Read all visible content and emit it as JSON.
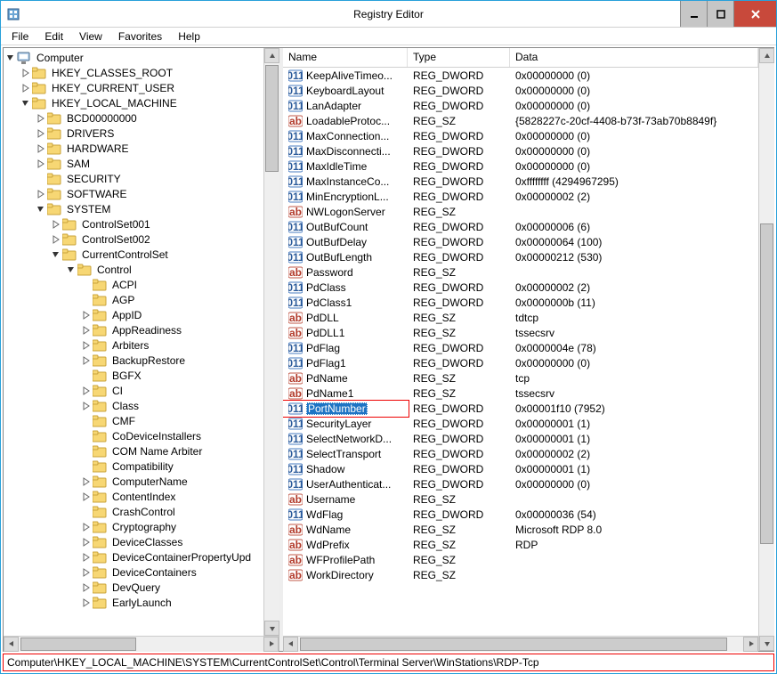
{
  "window": {
    "title": "Registry Editor"
  },
  "menu": {
    "file": "File",
    "edit": "Edit",
    "view": "View",
    "favorites": "Favorites",
    "help": "Help"
  },
  "tree": [
    {
      "depth": 0,
      "exp": "open",
      "icon": "computer",
      "label": "Computer"
    },
    {
      "depth": 1,
      "exp": "closed",
      "icon": "folder",
      "label": "HKEY_CLASSES_ROOT"
    },
    {
      "depth": 1,
      "exp": "closed",
      "icon": "folder",
      "label": "HKEY_CURRENT_USER"
    },
    {
      "depth": 1,
      "exp": "open",
      "icon": "folder",
      "label": "HKEY_LOCAL_MACHINE"
    },
    {
      "depth": 2,
      "exp": "closed",
      "icon": "folder",
      "label": "BCD00000000"
    },
    {
      "depth": 2,
      "exp": "closed",
      "icon": "folder",
      "label": "DRIVERS"
    },
    {
      "depth": 2,
      "exp": "closed",
      "icon": "folder",
      "label": "HARDWARE"
    },
    {
      "depth": 2,
      "exp": "closed",
      "icon": "folder",
      "label": "SAM"
    },
    {
      "depth": 2,
      "exp": "none",
      "icon": "folder",
      "label": "SECURITY"
    },
    {
      "depth": 2,
      "exp": "closed",
      "icon": "folder",
      "label": "SOFTWARE"
    },
    {
      "depth": 2,
      "exp": "open",
      "icon": "folder",
      "label": "SYSTEM"
    },
    {
      "depth": 3,
      "exp": "closed",
      "icon": "folder",
      "label": "ControlSet001"
    },
    {
      "depth": 3,
      "exp": "closed",
      "icon": "folder",
      "label": "ControlSet002"
    },
    {
      "depth": 3,
      "exp": "open",
      "icon": "folder",
      "label": "CurrentControlSet"
    },
    {
      "depth": 4,
      "exp": "open",
      "icon": "folder",
      "label": "Control"
    },
    {
      "depth": 5,
      "exp": "none",
      "icon": "folder",
      "label": "ACPI"
    },
    {
      "depth": 5,
      "exp": "none",
      "icon": "folder",
      "label": "AGP"
    },
    {
      "depth": 5,
      "exp": "closed",
      "icon": "folder",
      "label": "AppID"
    },
    {
      "depth": 5,
      "exp": "closed",
      "icon": "folder",
      "label": "AppReadiness"
    },
    {
      "depth": 5,
      "exp": "closed",
      "icon": "folder",
      "label": "Arbiters"
    },
    {
      "depth": 5,
      "exp": "closed",
      "icon": "folder",
      "label": "BackupRestore"
    },
    {
      "depth": 5,
      "exp": "none",
      "icon": "folder",
      "label": "BGFX"
    },
    {
      "depth": 5,
      "exp": "closed",
      "icon": "folder",
      "label": "CI"
    },
    {
      "depth": 5,
      "exp": "closed",
      "icon": "folder",
      "label": "Class"
    },
    {
      "depth": 5,
      "exp": "none",
      "icon": "folder",
      "label": "CMF"
    },
    {
      "depth": 5,
      "exp": "none",
      "icon": "folder",
      "label": "CoDeviceInstallers"
    },
    {
      "depth": 5,
      "exp": "none",
      "icon": "folder",
      "label": "COM Name Arbiter"
    },
    {
      "depth": 5,
      "exp": "none",
      "icon": "folder",
      "label": "Compatibility"
    },
    {
      "depth": 5,
      "exp": "closed",
      "icon": "folder",
      "label": "ComputerName"
    },
    {
      "depth": 5,
      "exp": "closed",
      "icon": "folder",
      "label": "ContentIndex"
    },
    {
      "depth": 5,
      "exp": "none",
      "icon": "folder",
      "label": "CrashControl"
    },
    {
      "depth": 5,
      "exp": "closed",
      "icon": "folder",
      "label": "Cryptography"
    },
    {
      "depth": 5,
      "exp": "closed",
      "icon": "folder",
      "label": "DeviceClasses"
    },
    {
      "depth": 5,
      "exp": "closed",
      "icon": "folder",
      "label": "DeviceContainerPropertyUpd"
    },
    {
      "depth": 5,
      "exp": "closed",
      "icon": "folder",
      "label": "DeviceContainers"
    },
    {
      "depth": 5,
      "exp": "closed",
      "icon": "folder",
      "label": "DevQuery"
    },
    {
      "depth": 5,
      "exp": "closed",
      "icon": "folder",
      "label": "EarlyLaunch"
    }
  ],
  "columns": {
    "name": "Name",
    "type": "Type",
    "data": "Data"
  },
  "colw": {
    "name": 140,
    "type": 115,
    "data": 260
  },
  "values": [
    {
      "icon": "num",
      "name": "KeepAliveTimeo...",
      "type": "REG_DWORD",
      "data": "0x00000000 (0)"
    },
    {
      "icon": "num",
      "name": "KeyboardLayout",
      "type": "REG_DWORD",
      "data": "0x00000000 (0)"
    },
    {
      "icon": "num",
      "name": "LanAdapter",
      "type": "REG_DWORD",
      "data": "0x00000000 (0)"
    },
    {
      "icon": "str",
      "name": "LoadableProtoc...",
      "type": "REG_SZ",
      "data": "{5828227c-20cf-4408-b73f-73ab70b8849f}"
    },
    {
      "icon": "num",
      "name": "MaxConnection...",
      "type": "REG_DWORD",
      "data": "0x00000000 (0)"
    },
    {
      "icon": "num",
      "name": "MaxDisconnecti...",
      "type": "REG_DWORD",
      "data": "0x00000000 (0)"
    },
    {
      "icon": "num",
      "name": "MaxIdleTime",
      "type": "REG_DWORD",
      "data": "0x00000000 (0)"
    },
    {
      "icon": "num",
      "name": "MaxInstanceCo...",
      "type": "REG_DWORD",
      "data": "0xffffffff (4294967295)"
    },
    {
      "icon": "num",
      "name": "MinEncryptionL...",
      "type": "REG_DWORD",
      "data": "0x00000002 (2)"
    },
    {
      "icon": "str",
      "name": "NWLogonServer",
      "type": "REG_SZ",
      "data": ""
    },
    {
      "icon": "num",
      "name": "OutBufCount",
      "type": "REG_DWORD",
      "data": "0x00000006 (6)"
    },
    {
      "icon": "num",
      "name": "OutBufDelay",
      "type": "REG_DWORD",
      "data": "0x00000064 (100)"
    },
    {
      "icon": "num",
      "name": "OutBufLength",
      "type": "REG_DWORD",
      "data": "0x00000212 (530)"
    },
    {
      "icon": "str",
      "name": "Password",
      "type": "REG_SZ",
      "data": ""
    },
    {
      "icon": "num",
      "name": "PdClass",
      "type": "REG_DWORD",
      "data": "0x00000002 (2)"
    },
    {
      "icon": "num",
      "name": "PdClass1",
      "type": "REG_DWORD",
      "data": "0x0000000b (11)"
    },
    {
      "icon": "str",
      "name": "PdDLL",
      "type": "REG_SZ",
      "data": "tdtcp"
    },
    {
      "icon": "str",
      "name": "PdDLL1",
      "type": "REG_SZ",
      "data": "tssecsrv"
    },
    {
      "icon": "num",
      "name": "PdFlag",
      "type": "REG_DWORD",
      "data": "0x0000004e (78)"
    },
    {
      "icon": "num",
      "name": "PdFlag1",
      "type": "REG_DWORD",
      "data": "0x00000000 (0)"
    },
    {
      "icon": "str",
      "name": "PdName",
      "type": "REG_SZ",
      "data": "tcp"
    },
    {
      "icon": "str",
      "name": "PdName1",
      "type": "REG_SZ",
      "data": "tssecsrv"
    },
    {
      "icon": "num",
      "name": "PortNumber",
      "type": "REG_DWORD",
      "data": "0x00001f10 (7952)",
      "selected": true,
      "highlight": true
    },
    {
      "icon": "num",
      "name": "SecurityLayer",
      "type": "REG_DWORD",
      "data": "0x00000001 (1)"
    },
    {
      "icon": "num",
      "name": "SelectNetworkD...",
      "type": "REG_DWORD",
      "data": "0x00000001 (1)"
    },
    {
      "icon": "num",
      "name": "SelectTransport",
      "type": "REG_DWORD",
      "data": "0x00000002 (2)"
    },
    {
      "icon": "num",
      "name": "Shadow",
      "type": "REG_DWORD",
      "data": "0x00000001 (1)"
    },
    {
      "icon": "num",
      "name": "UserAuthenticat...",
      "type": "REG_DWORD",
      "data": "0x00000000 (0)"
    },
    {
      "icon": "str",
      "name": "Username",
      "type": "REG_SZ",
      "data": ""
    },
    {
      "icon": "num",
      "name": "WdFlag",
      "type": "REG_DWORD",
      "data": "0x00000036 (54)"
    },
    {
      "icon": "str",
      "name": "WdName",
      "type": "REG_SZ",
      "data": "Microsoft RDP 8.0"
    },
    {
      "icon": "str",
      "name": "WdPrefix",
      "type": "REG_SZ",
      "data": "RDP"
    },
    {
      "icon": "str",
      "name": "WFProfilePath",
      "type": "REG_SZ",
      "data": ""
    },
    {
      "icon": "str",
      "name": "WorkDirectory",
      "type": "REG_SZ",
      "data": ""
    }
  ],
  "statusbar": {
    "path": "Computer\\HKEY_LOCAL_MACHINE\\SYSTEM\\CurrentControlSet\\Control\\Terminal Server\\WinStations\\RDP-Tcp"
  }
}
